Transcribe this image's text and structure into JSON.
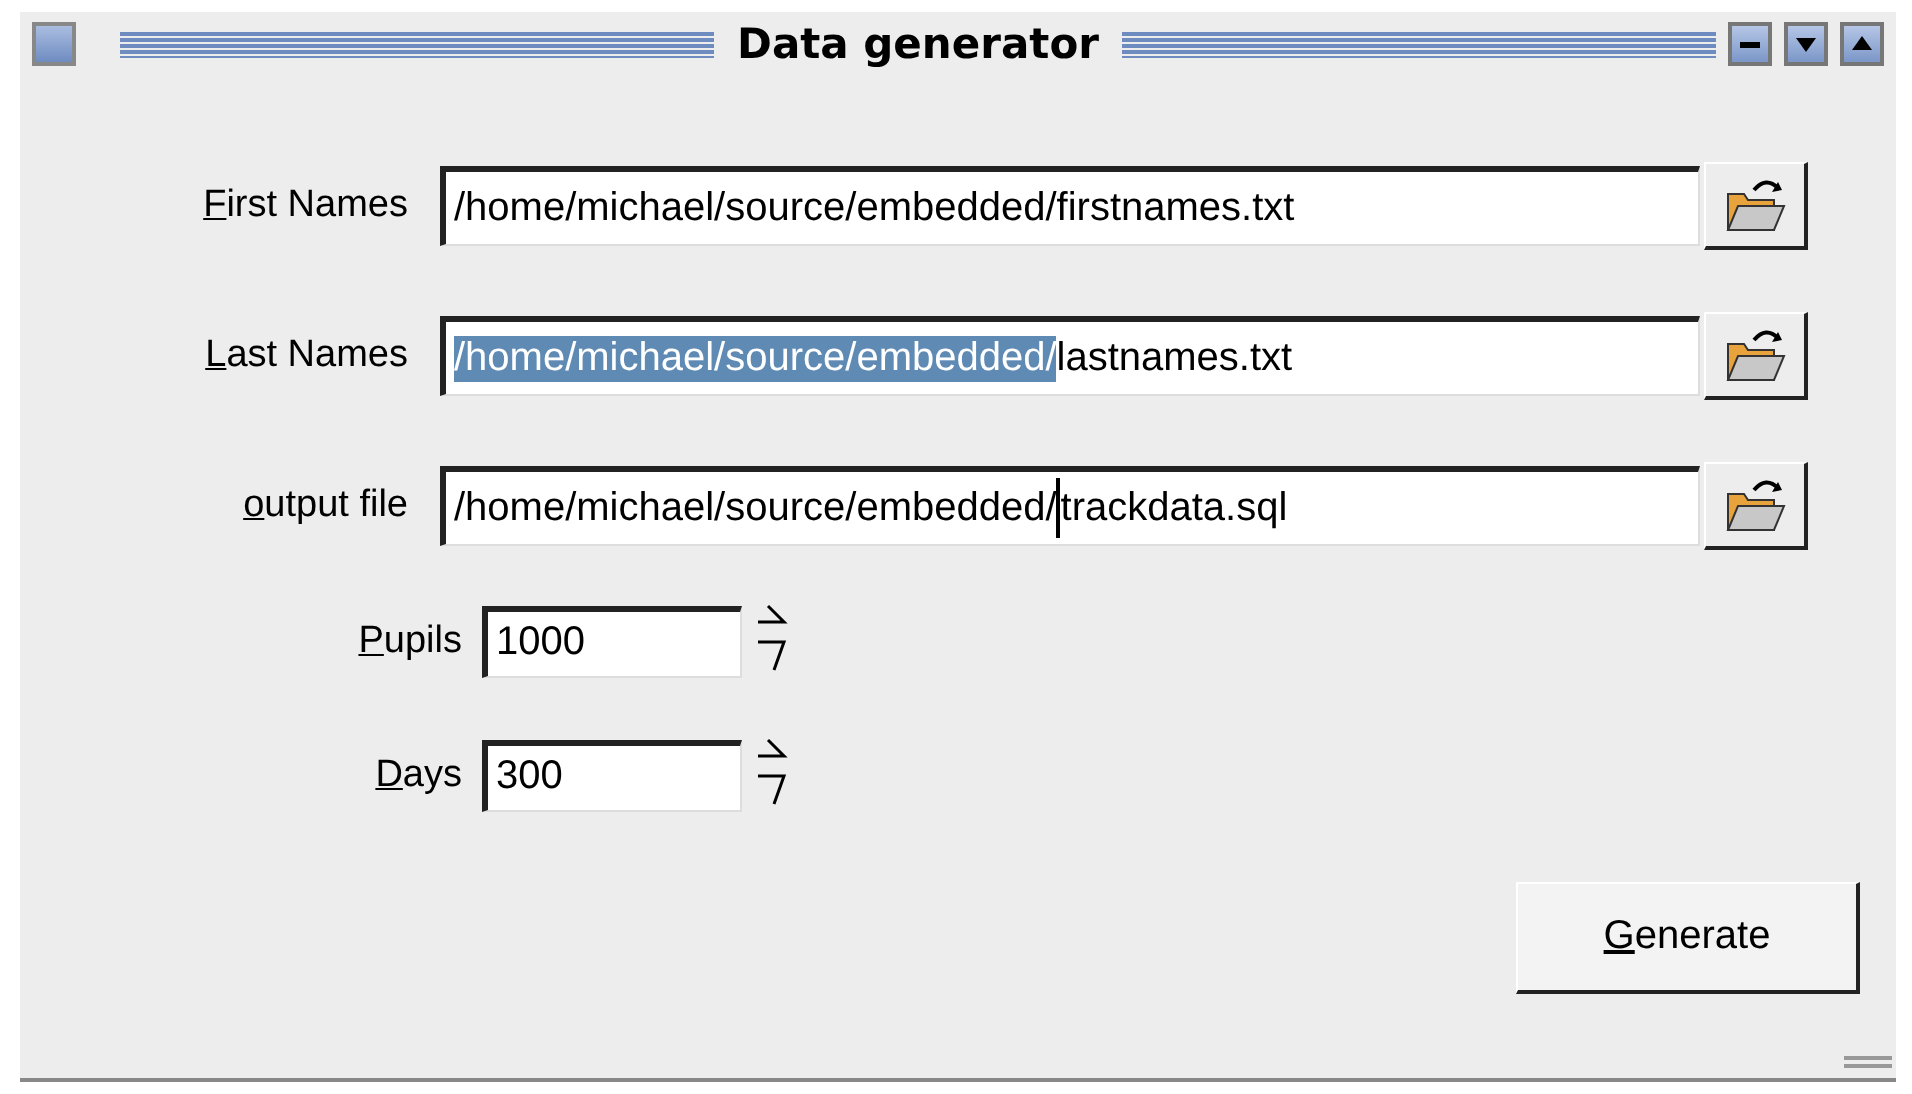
{
  "window": {
    "title": "Data generator"
  },
  "file_rows": [
    {
      "label": "First Names",
      "parts": [
        {
          "text": "/home/michael/source/embedded/firstnames.txt",
          "selected": false,
          "caret": false
        }
      ]
    },
    {
      "label": "Last Names",
      "parts": [
        {
          "text": "/home/michael/source/embedded/",
          "selected": true,
          "caret": false
        },
        {
          "text": "lastnames.txt",
          "selected": false,
          "caret": false
        }
      ]
    },
    {
      "label": "output file",
      "parts": [
        {
          "text": "/home/michael/source/embedded/",
          "selected": false,
          "caret": false
        },
        {
          "text": "trackdata.sql",
          "selected": false,
          "caret": true
        }
      ]
    }
  ],
  "spin_rows": [
    {
      "label": "Pupils",
      "value": "1000"
    },
    {
      "label": "Days",
      "value": "300"
    }
  ],
  "buttons": [
    "Generate"
  ]
}
